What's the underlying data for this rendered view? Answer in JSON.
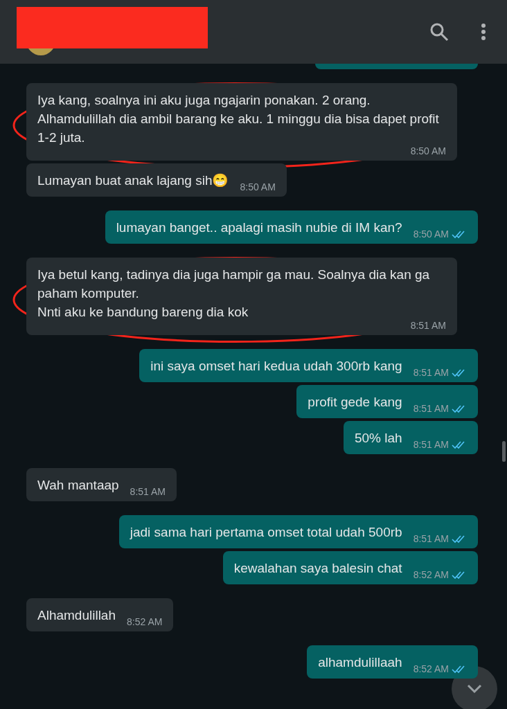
{
  "messages": [
    {
      "kind": "incoming",
      "text": "Iya kang, soalnya ini aku juga ngajarin ponakan. 2 orang. Alhamdulillah dia ambil barang ke aku. 1 minggu dia bisa dapet profit 1-2 juta.",
      "time": "8:50 AM",
      "circled": true
    },
    {
      "kind": "incoming",
      "text": "Lumayan buat anak lajang sih😁",
      "time": "8:50 AM",
      "circled": false
    },
    {
      "kind": "outgoing",
      "text": "lumayan banget.. apalagi masih nubie di IM kan?",
      "time": "8:50 AM",
      "read": true
    },
    {
      "kind": "incoming",
      "text": "Iya betul kang, tadinya dia juga hampir ga mau. Soalnya dia kan ga paham komputer.\nNnti aku ke bandung bareng dia kok",
      "time": "8:51 AM",
      "circled": true
    },
    {
      "kind": "outgoing",
      "text": "ini saya omset hari kedua udah 300rb kang",
      "time": "8:51 AM",
      "read": true
    },
    {
      "kind": "outgoing",
      "text": "profit gede kang",
      "time": "8:51 AM",
      "read": true
    },
    {
      "kind": "outgoing",
      "text": "50% lah",
      "time": "8:51 AM",
      "read": true
    },
    {
      "kind": "incoming",
      "text": "Wah mantaap",
      "time": "8:51 AM",
      "circled": false
    },
    {
      "kind": "outgoing",
      "text": "jadi sama hari pertama omset total udah 500rb",
      "time": "8:51 AM",
      "read": true
    },
    {
      "kind": "outgoing",
      "text": "kewalahan saya balesin chat",
      "time": "8:52 AM",
      "read": true
    },
    {
      "kind": "incoming",
      "text": "Alhamdulillah",
      "time": "8:52 AM",
      "circled": false
    },
    {
      "kind": "outgoing",
      "text": "alhamdulillaah",
      "time": "8:52 AM",
      "read": true
    }
  ]
}
